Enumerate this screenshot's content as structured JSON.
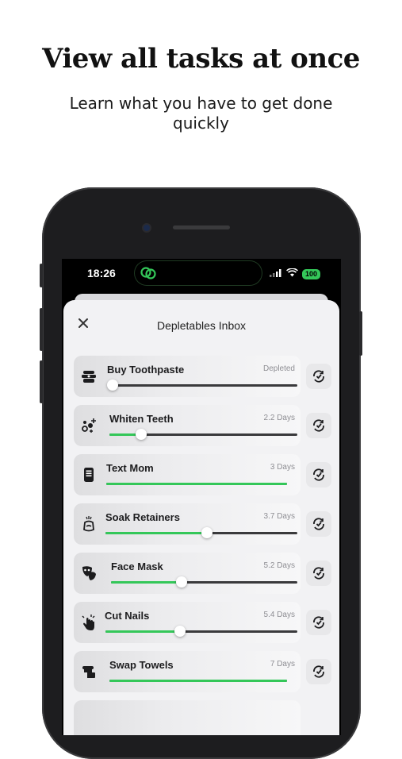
{
  "promo": {
    "headline": "View all tasks at once",
    "subline": "Learn what you have to get done quickly"
  },
  "status_bar": {
    "time": "18:26",
    "battery": "100"
  },
  "sheet": {
    "title": "Depletables Inbox"
  },
  "colors": {
    "accent": "#34c759",
    "track": "#3a3a3c"
  },
  "tasks": [
    {
      "name": "Buy Toothpaste",
      "when": "Depleted",
      "level": 0.0,
      "icon": "toothpaste-icon",
      "show_knob": true
    },
    {
      "name": "Whiten Teeth",
      "when": "2.2 Days",
      "level": 0.17,
      "icon": "sparkle-icon",
      "show_knob": true
    },
    {
      "name": "Text Mom",
      "when": "3 Days",
      "level": 1.0,
      "icon": "phone-icon",
      "show_knob": false
    },
    {
      "name": "Soak Retainers",
      "when": "3.7 Days",
      "level": 0.53,
      "icon": "retainer-icon",
      "show_knob": true
    },
    {
      "name": "Face Mask",
      "when": "5.2 Days",
      "level": 0.38,
      "icon": "mask-icon",
      "show_knob": true
    },
    {
      "name": "Cut Nails",
      "when": "5.4 Days",
      "level": 0.39,
      "icon": "hand-icon",
      "show_knob": true
    },
    {
      "name": "Swap Towels",
      "when": "7 Days",
      "level": 1.0,
      "icon": "towel-icon",
      "show_knob": false
    }
  ]
}
